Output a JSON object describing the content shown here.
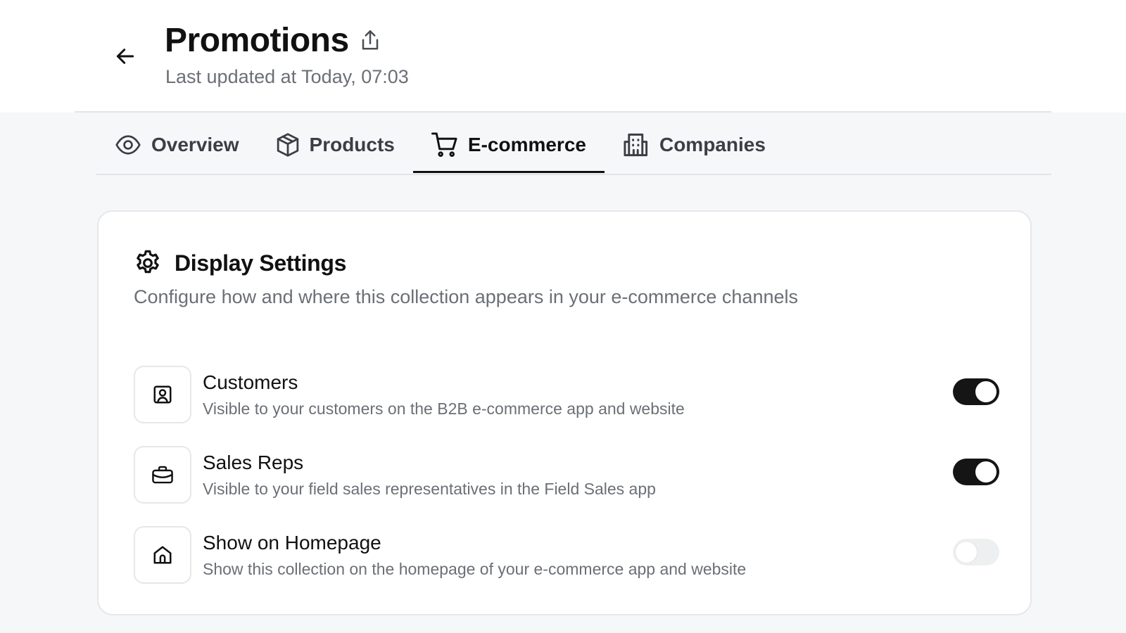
{
  "header": {
    "title": "Promotions",
    "subtitle": "Last updated at Today, 07:03"
  },
  "tabs": [
    {
      "label": "Overview",
      "icon": "eye-icon",
      "active": false
    },
    {
      "label": "Products",
      "icon": "package-icon",
      "active": false
    },
    {
      "label": "E-commerce",
      "icon": "cart-icon",
      "active": true
    },
    {
      "label": "Companies",
      "icon": "building-icon",
      "active": false
    }
  ],
  "card": {
    "title": "Display Settings",
    "description": "Configure how and where this collection appears in your e-commerce channels",
    "rows": [
      {
        "title": "Customers",
        "description": "Visible to your customers on the B2B e-commerce app and website",
        "icon": "user-square-icon",
        "enabled": true
      },
      {
        "title": "Sales Reps",
        "description": "Visible to your field sales representatives in the Field Sales app",
        "icon": "briefcase-icon",
        "enabled": true
      },
      {
        "title": "Show on Homepage",
        "description": "Show this collection on the homepage of your e-commerce app and website",
        "icon": "home-icon",
        "enabled": false
      }
    ]
  },
  "colors": {
    "toggle_on": "#151515",
    "toggle_off": "#eeeff1",
    "text_muted": "#6b6f76"
  }
}
